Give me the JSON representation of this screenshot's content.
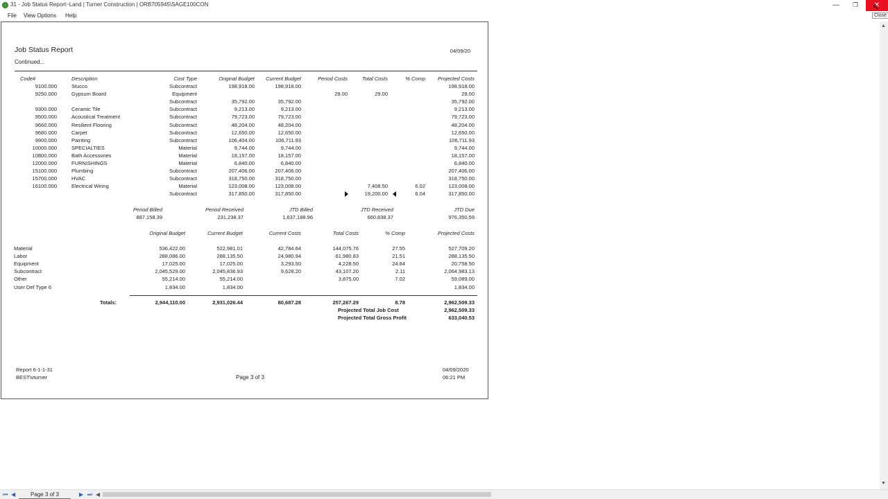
{
  "window": {
    "title": "31 - Job Status Report~Land  |  Turner Construction  |  ORB705945\\SAGE100CON",
    "min_icon": "minimize-icon",
    "max_icon": "restore-icon",
    "close_icon": "close-icon",
    "close_tooltip": "Close"
  },
  "menu": {
    "file": "File",
    "view": "View Options",
    "help": "Help"
  },
  "report": {
    "title": "Job Status Report",
    "subtitle": "Continued...",
    "date": "04/09/20",
    "headers": [
      "Code#",
      "Description",
      "Cost Type",
      "Original Budget",
      "Current Budget",
      "Period Costs",
      "Total Costs",
      "% Comp",
      "Projected Costs"
    ],
    "rows": [
      [
        "9100.000",
        "Stucco",
        "Subcontract",
        "198,918.00",
        "198,918.00",
        "",
        "",
        "",
        "198,918.00"
      ],
      [
        "9250.000",
        "Gypsum Board",
        "Equipment",
        "",
        "",
        "29.00",
        "29.00",
        "",
        "29.00"
      ],
      [
        "",
        "",
        "Subcontract",
        "35,792.00",
        "35,792.00",
        "",
        "",
        "",
        "35,792.00"
      ],
      [
        "9300.000",
        "Ceramic Tile",
        "Subcontract",
        "9,213.00",
        "9,213.00",
        "",
        "",
        "",
        "9,213.00"
      ],
      [
        "9500.000",
        "Acoustical Treatment",
        "Subcontract",
        "79,723.00",
        "79,723.00",
        "",
        "",
        "",
        "79,723.00"
      ],
      [
        "9660.000",
        "Resilient Flooring",
        "Subcontract",
        "48,204.00",
        "48,204.00",
        "",
        "",
        "",
        "48,204.00"
      ],
      [
        "9680.000",
        "Carpet",
        "Subcontract",
        "12,650.00",
        "12,650.00",
        "",
        "",
        "",
        "12,650.00"
      ],
      [
        "9900.000",
        "Painting",
        "Subcontract",
        "106,404.00",
        "106,711.93",
        "",
        "",
        "",
        "106,711.93"
      ],
      [
        "10000.000",
        "SPECIALTIES",
        "Material",
        "9,744.00",
        "9,744.00",
        "",
        "",
        "",
        "9,744.00"
      ],
      [
        "10800.000",
        "Bath Accessories",
        "Material",
        "18,157.00",
        "18,157.00",
        "",
        "",
        "",
        "18,157.00"
      ],
      [
        "12000.000",
        "FURNISHINGS",
        "Material",
        "6,840.00",
        "6,840.00",
        "",
        "",
        "",
        "6,840.00"
      ],
      [
        "15100.000",
        "Plumbing",
        "Subcontract",
        "207,406.00",
        "207,406.00",
        "",
        "",
        "",
        "207,406.00"
      ],
      [
        "15700.000",
        "HVAC",
        "Subcontract",
        "318,750.00",
        "318,750.00",
        "",
        "",
        "",
        "318,750.00"
      ],
      [
        "16100.000",
        "Electrical Wiring",
        "Material",
        "123,008.00",
        "123,008.00",
        "",
        "7,408.50",
        "6.02",
        "123,008.00"
      ],
      [
        "",
        "",
        "Subcontract",
        "317,850.00",
        "317,850.00",
        "",
        "19,200.00",
        "6.04",
        "317,850.00"
      ]
    ],
    "billing_headers": [
      "Period Billed",
      "Period Received",
      "JTD Billed",
      "JTD Received",
      "JTD Due"
    ],
    "billing_values": [
      "887,158.39",
      "231,238.37",
      "1,637,188.96",
      "660,838.37",
      "976,350.59"
    ],
    "summary_headers": [
      "Original Budget",
      "Current Budget",
      "Current Costs",
      "Total Costs",
      "% Comp",
      "Projected Costs"
    ],
    "summary_rows": [
      [
        "Material",
        "536,422.00",
        "522,981.01",
        "42,784.64",
        "144,075.76",
        "27.55",
        "527,709.20"
      ],
      [
        "Labor",
        "288,086.00",
        "288,135.50",
        "24,980.94",
        "61,980.83",
        "21.51",
        "288,135.50"
      ],
      [
        "Equipment",
        "17,025.00",
        "17,025.00",
        "3,293.50",
        "4,228.50",
        "24.84",
        "20,758.50"
      ],
      [
        "Subcontract",
        "2,045,529.00",
        "2,045,836.93",
        "9,628.20",
        "43,107.20",
        "2.11",
        "2,064,983.13"
      ],
      [
        "Other",
        "55,214.00",
        "55,214.00",
        "",
        "3,875.00",
        "7.02",
        "59,089.00"
      ],
      [
        "User Def Type 6",
        "1,834.00",
        "1,834.00",
        "",
        "",
        "",
        "1,834.00"
      ]
    ],
    "totals_label": "Totals:",
    "totals": [
      "2,944,110.00",
      "2,931,026.44",
      "80,687.28",
      "257,267.29",
      "8.78",
      "2,962,509.33"
    ],
    "proj_job_cost_label": "Projected Total Job Cost",
    "proj_job_cost": "2,962,509.33",
    "proj_profit_label": "Projected Total Gross Profit",
    "proj_profit": "633,040.53",
    "footer_report": "Report  6-1-1-31",
    "footer_user": "BEST\\vturner",
    "footer_page": "Page   3 of 3",
    "footer_date": "04/09/2020",
    "footer_time": "06:21 PM"
  },
  "bottom": {
    "page_indicator": "Page 3 of 3"
  }
}
